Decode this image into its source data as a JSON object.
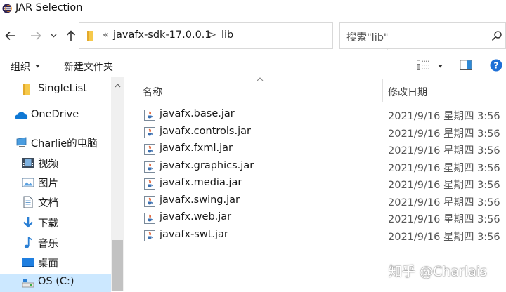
{
  "window": {
    "title": "JAR Selection"
  },
  "address": {
    "overflow": "«",
    "crumbs": [
      "javafx-sdk-17.0.0.1",
      "lib"
    ],
    "separator": ">"
  },
  "search": {
    "placeholder": "搜索\"lib\""
  },
  "toolbar": {
    "organize_label": "组织",
    "new_folder_label": "新建文件夹"
  },
  "sidebar": {
    "items": [
      {
        "label": "SingleList",
        "icon": "folder-icon"
      },
      {
        "label": "OneDrive",
        "icon": "cloud-icon"
      },
      {
        "label": "Charlie的电脑",
        "icon": "computer-icon"
      },
      {
        "label": "视频",
        "icon": "video-icon"
      },
      {
        "label": "图片",
        "icon": "picture-icon"
      },
      {
        "label": "文档",
        "icon": "document-icon"
      },
      {
        "label": "下载",
        "icon": "download-icon"
      },
      {
        "label": "音乐",
        "icon": "music-icon"
      },
      {
        "label": "桌面",
        "icon": "desktop-icon"
      },
      {
        "label": "OS (C:)",
        "icon": "drive-icon"
      }
    ]
  },
  "list": {
    "columns": {
      "name": "名称",
      "date": "修改日期"
    },
    "rows": [
      {
        "name": "javafx.base.jar",
        "date": "2021/9/16 星期四 3:56"
      },
      {
        "name": "javafx.controls.jar",
        "date": "2021/9/16 星期四 3:56"
      },
      {
        "name": "javafx.fxml.jar",
        "date": "2021/9/16 星期四 3:56"
      },
      {
        "name": "javafx.graphics.jar",
        "date": "2021/9/16 星期四 3:56"
      },
      {
        "name": "javafx.media.jar",
        "date": "2021/9/16 星期四 3:56"
      },
      {
        "name": "javafx.swing.jar",
        "date": "2021/9/16 星期四 3:56"
      },
      {
        "name": "javafx.web.jar",
        "date": "2021/9/16 星期四 3:56"
      },
      {
        "name": "javafx-swt.jar",
        "date": "2021/9/16 星期四 3:56"
      }
    ]
  },
  "watermark": "知乎 @Charlais",
  "colors": {
    "selected_bg": "#cce8ff",
    "folder": "#f6c94b",
    "onedrive": "#0f78d4"
  }
}
